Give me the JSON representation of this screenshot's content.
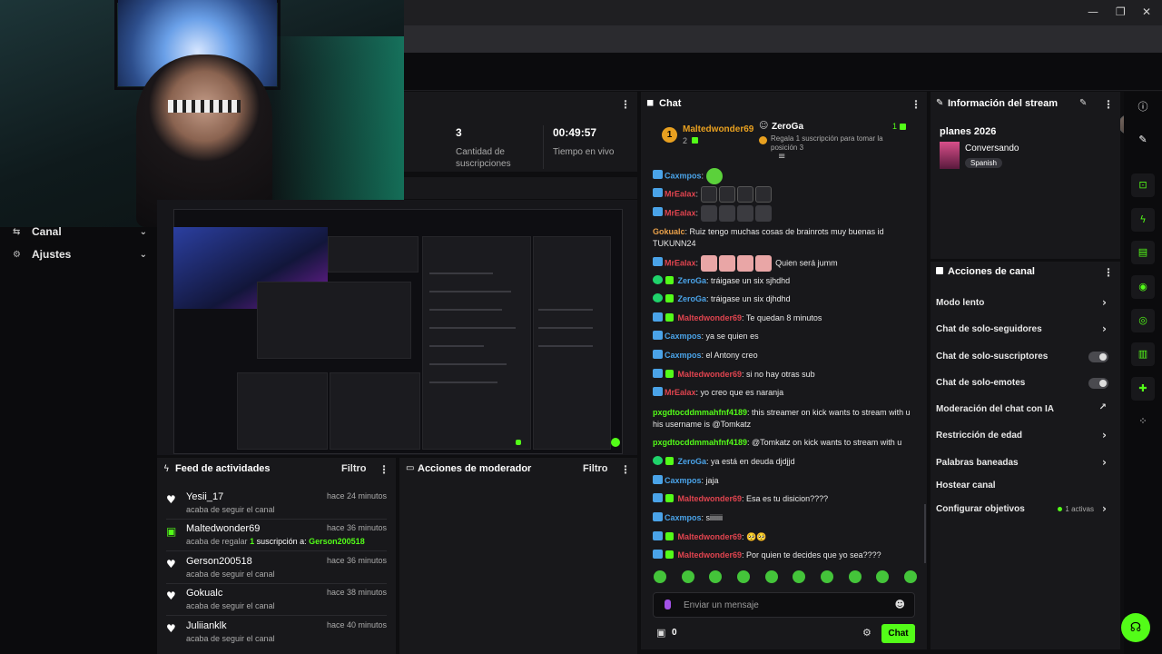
{
  "nav": {
    "items": [
      {
        "label": "Canal",
        "icon": "flow-icon"
      },
      {
        "label": "Ajustes",
        "icon": "gear-icon"
      }
    ]
  },
  "stats": {
    "subs_value": "3",
    "subs_caption": "Cantidad de suscripciones",
    "live_value": "00:49:57",
    "live_caption": "Tiempo en vivo"
  },
  "feed": {
    "title": "Feed de actividades",
    "filter": "Filtro",
    "items": [
      {
        "name": "Yesii_17",
        "time": "hace 24 minutos",
        "sub": "acaba de seguir el canal",
        "kind": "follow"
      },
      {
        "name": "Maltedwonder69",
        "time": "hace 36 minutos",
        "sub_pre": "acaba de regalar",
        "sub_count": "1",
        "sub_mid": "suscripción a:",
        "sub_target": "Gerson200518",
        "kind": "gift"
      },
      {
        "name": "Gerson200518",
        "time": "hace 36 minutos",
        "sub": "acaba de seguir el canal",
        "kind": "follow"
      },
      {
        "name": "Gokualc",
        "time": "hace 38 minutos",
        "sub": "acaba de seguir el canal",
        "kind": "follow"
      },
      {
        "name": "Juliianklk",
        "time": "hace 40 minutos",
        "sub": "acaba de seguir el canal",
        "kind": "follow"
      }
    ]
  },
  "moderator": {
    "title": "Acciones de moderador",
    "filter": "Filtro"
  },
  "chat": {
    "title": "Chat",
    "pinned": {
      "rank": "1",
      "user": "Maltedwonder69",
      "user_count": "2",
      "gifter": "ZeroGa",
      "gifter_count": "1",
      "gifter_text": "Regala 1 suscripción para tomar la posición 3"
    },
    "messages": [
      {
        "user": "Caxmpos",
        "color": "#4aa3e8",
        "text": "",
        "emotes": "gr1",
        "badges": "v"
      },
      {
        "user": "MrEalax",
        "color": "#e0444f",
        "text": "",
        "emotes": "sk4",
        "badges": "v"
      },
      {
        "user": "MrEalax",
        "color": "#e0444f",
        "text": "",
        "emotes": "dk4",
        "badges": "v"
      },
      {
        "user": "Gokualc",
        "color": "#e8a04a",
        "text": "Ruiz tengo muchas cosas de brainrots muy buenas id TUKUNN24",
        "emotes": "",
        "badges": ""
      },
      {
        "user": "MrEalax",
        "color": "#e0444f",
        "text": "Quien será jumm",
        "emotes": "pk4",
        "badges": "v"
      },
      {
        "user": "ZeroGa",
        "color": "#4aa3e8",
        "text": "tráigase un six sjhdhd",
        "emotes": "",
        "badges": "gs"
      },
      {
        "user": "ZeroGa",
        "color": "#4aa3e8",
        "text": "tráigase un six djhdhd",
        "emotes": "",
        "badges": "gs"
      },
      {
        "user": "Maltedwonder69",
        "color": "#e0444f",
        "text": "Te quedan 8 minutos",
        "emotes": "",
        "badges": "vs"
      },
      {
        "user": "Caxmpos",
        "color": "#4aa3e8",
        "text": "ya se quien es",
        "emotes": "",
        "badges": "v"
      },
      {
        "user": "Caxmpos",
        "color": "#4aa3e8",
        "text": "el Antony creo",
        "emotes": "",
        "badges": "v"
      },
      {
        "user": "Maltedwonder69",
        "color": "#e0444f",
        "text": "si no hay otras sub",
        "emotes": "",
        "badges": "vs"
      },
      {
        "user": "MrEalax",
        "color": "#e0444f",
        "text": "yo creo que es naranja",
        "emotes": "",
        "badges": "v"
      },
      {
        "user": "pxgdtocddmmahfnf4189",
        "color": "#53fc18",
        "text": "this streamer on kick wants to stream with u his username is @Tomkatz",
        "emotes": "",
        "badges": ""
      },
      {
        "user": "pxgdtocddmmahfnf4189",
        "color": "#53fc18",
        "text": "@Tomkatz on kick wants to stream with u",
        "emotes": "",
        "badges": ""
      },
      {
        "user": "ZeroGa",
        "color": "#4aa3e8",
        "text": "ya está en deuda djdjjd",
        "emotes": "",
        "badges": "gs"
      },
      {
        "user": "Caxmpos",
        "color": "#4aa3e8",
        "text": "jaja",
        "emotes": "",
        "badges": "v"
      },
      {
        "user": "Maltedwonder69",
        "color": "#e0444f",
        "text": "Esa es tu disicion????",
        "emotes": "",
        "badges": "vs"
      },
      {
        "user": "Caxmpos",
        "color": "#4aa3e8",
        "text": "siiiiiii",
        "emotes": "",
        "badges": "v"
      },
      {
        "user": "Maltedwonder69",
        "color": "#e0444f",
        "text": "🥺🥺",
        "emotes": "",
        "badges": "vs"
      },
      {
        "user": "Maltedwonder69",
        "color": "#e0444f",
        "text": "Por quien te decides que yo sea????",
        "emotes": "",
        "badges": "vs"
      }
    ],
    "input_placeholder": "Enviar un mensaje",
    "points": "0",
    "send_label": "Chat"
  },
  "info": {
    "title": "Información del stream",
    "stream_title": "planes 2026",
    "category": "Conversando",
    "language": "Spanish"
  },
  "actions": {
    "title": "Acciones de canal",
    "items": [
      {
        "label": "Modo lento",
        "control": "chevron"
      },
      {
        "label": "Chat de solo-seguidores",
        "control": "chevron"
      },
      {
        "label": "Chat de solo-suscriptores",
        "control": "toggle"
      },
      {
        "label": "Chat de solo-emotes",
        "control": "toggle"
      },
      {
        "label": "Moderación del chat con IA",
        "control": "external"
      },
      {
        "label": "Restricción de edad",
        "control": "chevron"
      },
      {
        "label": "Palabras baneadas",
        "control": "chevron"
      },
      {
        "label": "Hostear canal",
        "control": "none"
      },
      {
        "label": "Configurar objetivos",
        "control": "chevron",
        "extra": "1 activas"
      }
    ]
  },
  "colors": {
    "accent": "#53fc18",
    "panel": "#18181b",
    "bg": "#0e0e10"
  }
}
